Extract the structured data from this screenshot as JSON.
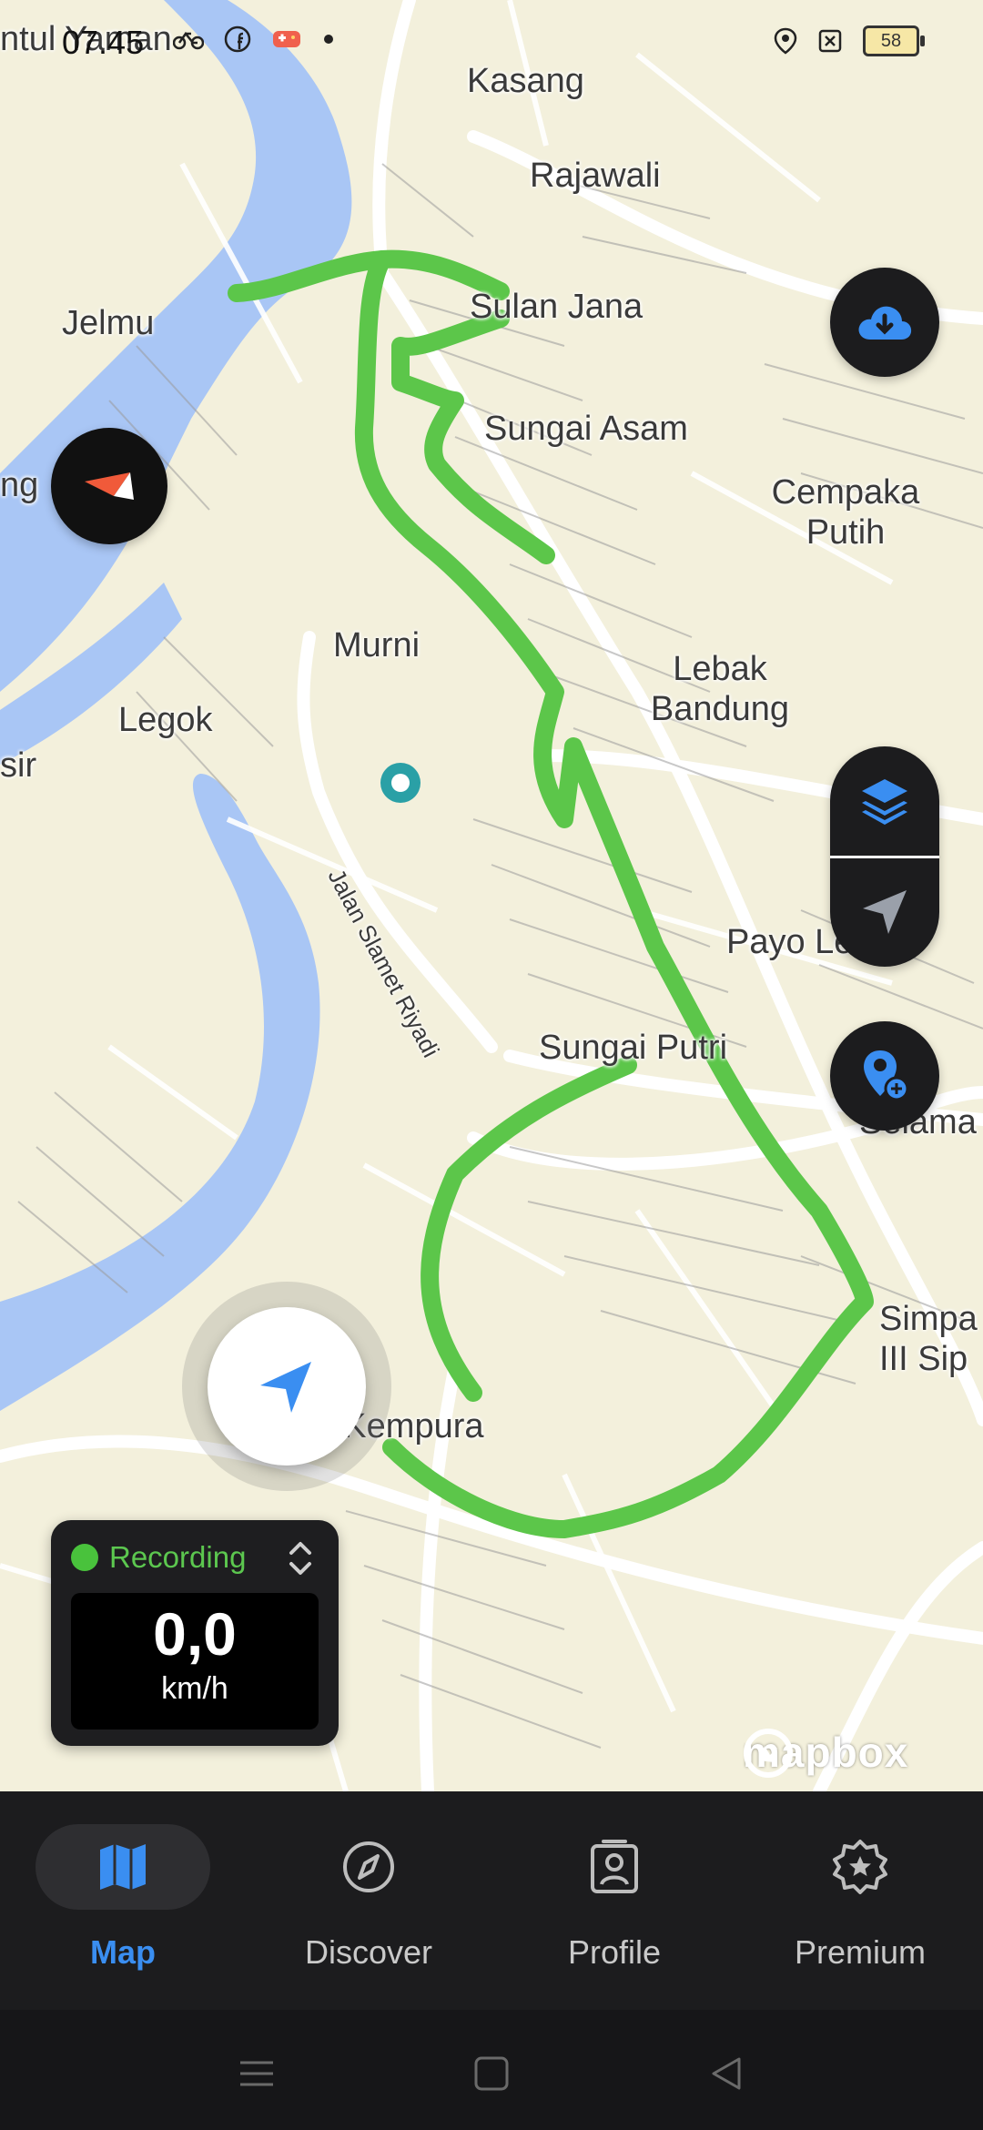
{
  "status_bar": {
    "time": "07.45",
    "battery": "58",
    "left_icons": [
      "bicycle-icon",
      "facebook-icon",
      "game-icon",
      "dot-icon"
    ],
    "right_icons": [
      "location-icon",
      "sim-off-icon",
      "battery-icon"
    ]
  },
  "map": {
    "places": [
      {
        "name": "Kasang"
      },
      {
        "name": "Rajawali"
      },
      {
        "name": "Sulan Jana"
      },
      {
        "name": "Jelmu"
      },
      {
        "name": "Sungai Asam"
      },
      {
        "name": "Cempaka Putih"
      },
      {
        "name": "Murni"
      },
      {
        "name": "Lebak Bandung"
      },
      {
        "name": "Legok"
      },
      {
        "name": "Payo Le"
      },
      {
        "name": "Sungai Putri"
      },
      {
        "name": "Selama"
      },
      {
        "name": "Simpa III Sip"
      },
      {
        "name": "Thehok Kempura"
      },
      {
        "name": "ntul Yaman"
      },
      {
        "name": "ng"
      },
      {
        "name": "sir"
      }
    ],
    "street_label": "Jalan Slamet Riyadi",
    "route_color": "#5cc64a",
    "water_color": "#a9c6f5",
    "attribution": "mapbox"
  },
  "buttons": {
    "download": "cloud-download-icon",
    "compass": "compass-icon",
    "layers": "layers-icon",
    "navigate": "navigation-arrow-icon",
    "add_poi": "add-location-icon",
    "recenter": "recenter-arrow-icon"
  },
  "recording": {
    "status": "Recording",
    "speed": "0,0",
    "unit": "km/h",
    "status_color": "#49c23c"
  },
  "tabs": [
    {
      "label": "Map",
      "icon": "map-icon",
      "active": true
    },
    {
      "label": "Discover",
      "icon": "compass-icon",
      "active": false
    },
    {
      "label": "Profile",
      "icon": "profile-icon",
      "active": false
    },
    {
      "label": "Premium",
      "icon": "premium-badge-icon",
      "active": false
    }
  ],
  "colors": {
    "accent": "#3a8ef1",
    "tabbar_bg": "#1c1c1e"
  }
}
